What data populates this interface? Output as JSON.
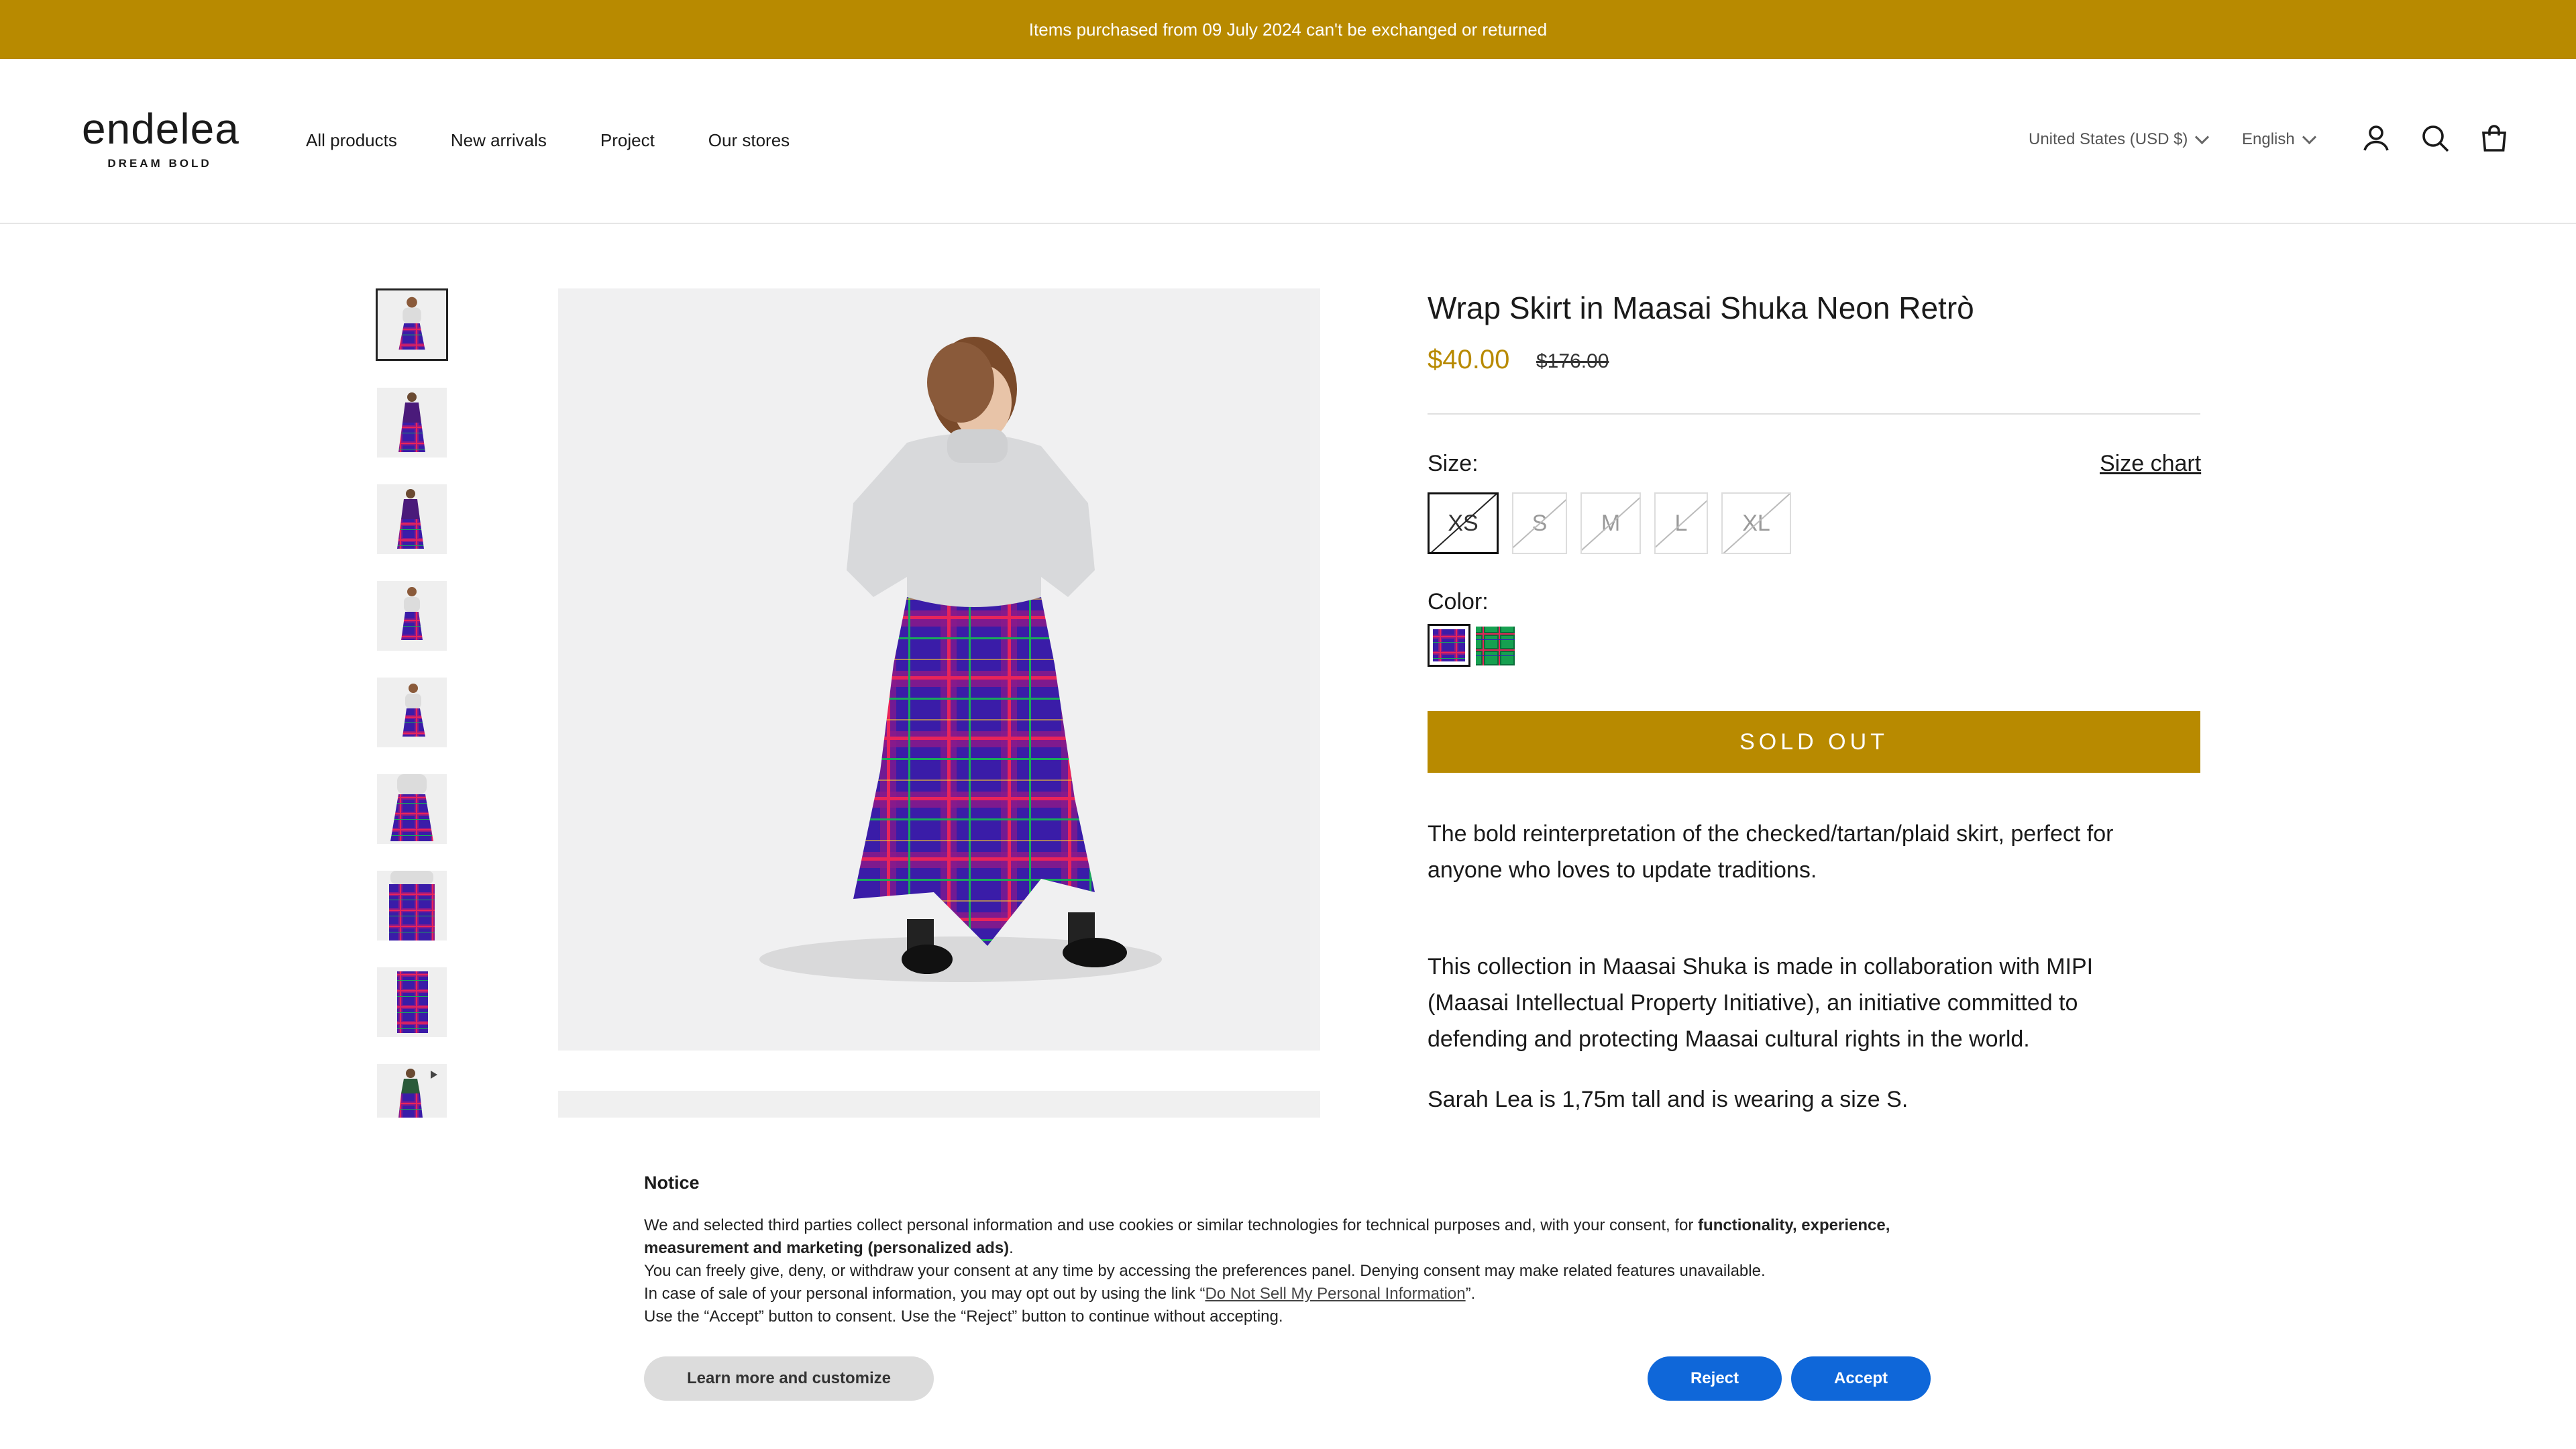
{
  "announcement": {
    "text": "Items purchased from 09 July 2024 can't be exchanged or returned"
  },
  "brand": {
    "name": "endelea",
    "tagline": "DREAM BOLD"
  },
  "nav": {
    "items": [
      "All products",
      "New arrivals",
      "Project",
      "Our stores"
    ]
  },
  "header": {
    "country": "United States (USD $)",
    "language": "English",
    "icons": [
      "account-icon",
      "search-icon",
      "cart-icon"
    ]
  },
  "gallery": {
    "thumbnail_count": 9,
    "selected_index": 0
  },
  "product": {
    "title": "Wrap Skirt in Maasai Shuka Neon Retrò",
    "price": "$40.00",
    "compare_price": "$176.00",
    "size_label": "Size:",
    "size_chart_label": "Size chart",
    "sizes": [
      "XS",
      "S",
      "M",
      "L",
      "XL"
    ],
    "selected_size": "XS",
    "sizes_unavailable": [
      "XS",
      "S",
      "M",
      "L",
      "XL"
    ],
    "color_label": "Color:",
    "colors": [
      "purple-plaid",
      "green-plaid"
    ],
    "selected_color": "purple-plaid",
    "sold_out_label": "SOLD OUT",
    "description": [
      "The bold reinterpretation of the checked/tartan/plaid skirt, perfect for anyone who loves to update traditions.",
      "This collection in Maasai Shuka is made in collaboration with MIPI (Maasai Intellectual Property Initiative), an initiative committed to defending and protecting Maasai cultural rights in the world.",
      "Sarah Lea is 1,75m tall and is wearing a size S."
    ]
  },
  "notice": {
    "title": "Notice",
    "line1_a": "We and selected third parties collect personal information and use cookies or similar technologies for technical purposes and, with your consent, for ",
    "line1_b": "functionality, experience, measurement and marketing (personalized ads)",
    "line1_c": ".",
    "line2": "You can freely give, deny, or withdraw your consent at any time by accessing the preferences panel. Denying consent may make related features unavailable.",
    "line3_a": "In case of sale of your personal information, you may opt out by using the link “",
    "line3_link": "Do Not Sell My Personal Information",
    "line3_b": "”.",
    "line4": "Use the “Accept” button to consent. Use the “Reject” button to continue without accepting.",
    "learn_more": "Learn more and customize",
    "reject": "Reject",
    "accept": "Accept"
  }
}
